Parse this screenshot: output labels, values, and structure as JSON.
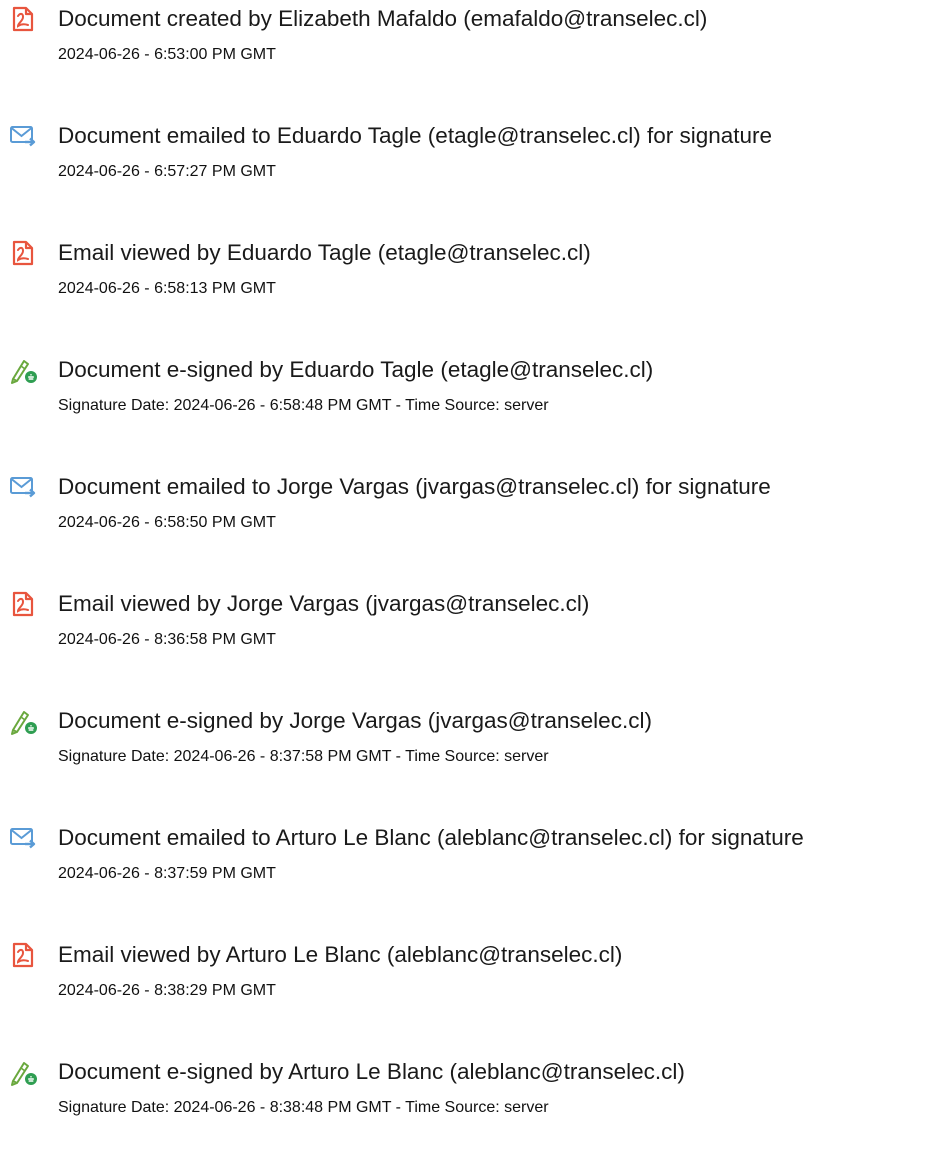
{
  "colors": {
    "created_viewed_icon": "#e8553e",
    "emailed_icon": "#5a9bd6",
    "signed_icon_pen": "#6aa83e",
    "signed_icon_badge": "#2f9e52"
  },
  "events": [
    {
      "icon": "document-created-icon",
      "title": "Document created by Elizabeth Mafaldo (emafaldo@transelec.cl)",
      "detail": "2024-06-26 - 6:53:00 PM GMT"
    },
    {
      "icon": "email-sent-icon",
      "title": "Document emailed to Eduardo Tagle (etagle@transelec.cl) for signature",
      "detail": "2024-06-26 - 6:57:27 PM GMT"
    },
    {
      "icon": "email-viewed-icon",
      "title": "Email viewed by Eduardo Tagle (etagle@transelec.cl)",
      "detail": "2024-06-26 - 6:58:13 PM GMT"
    },
    {
      "icon": "e-signature-pen-icon",
      "title": "Document e-signed by Eduardo Tagle (etagle@transelec.cl)",
      "detail": "Signature Date: 2024-06-26 - 6:58:48 PM GMT - Time Source: server"
    },
    {
      "icon": "email-sent-icon",
      "title": "Document emailed to Jorge Vargas (jvargas@transelec.cl) for signature",
      "detail": "2024-06-26 - 6:58:50 PM GMT"
    },
    {
      "icon": "email-viewed-icon",
      "title": "Email viewed by Jorge Vargas (jvargas@transelec.cl)",
      "detail": "2024-06-26 - 8:36:58 PM GMT"
    },
    {
      "icon": "e-signature-pen-icon",
      "title": "Document e-signed by Jorge Vargas (jvargas@transelec.cl)",
      "detail": "Signature Date: 2024-06-26 - 8:37:58 PM GMT - Time Source: server"
    },
    {
      "icon": "email-sent-icon",
      "title": "Document emailed to Arturo Le Blanc (aleblanc@transelec.cl) for signature",
      "detail": "2024-06-26 - 8:37:59 PM GMT"
    },
    {
      "icon": "email-viewed-icon",
      "title": "Email viewed by Arturo Le Blanc (aleblanc@transelec.cl)",
      "detail": "2024-06-26 - 8:38:29 PM GMT"
    },
    {
      "icon": "e-signature-pen-icon",
      "title": "Document e-signed by Arturo Le Blanc (aleblanc@transelec.cl)",
      "detail": "Signature Date: 2024-06-26 - 8:38:48 PM GMT - Time Source: server"
    }
  ]
}
